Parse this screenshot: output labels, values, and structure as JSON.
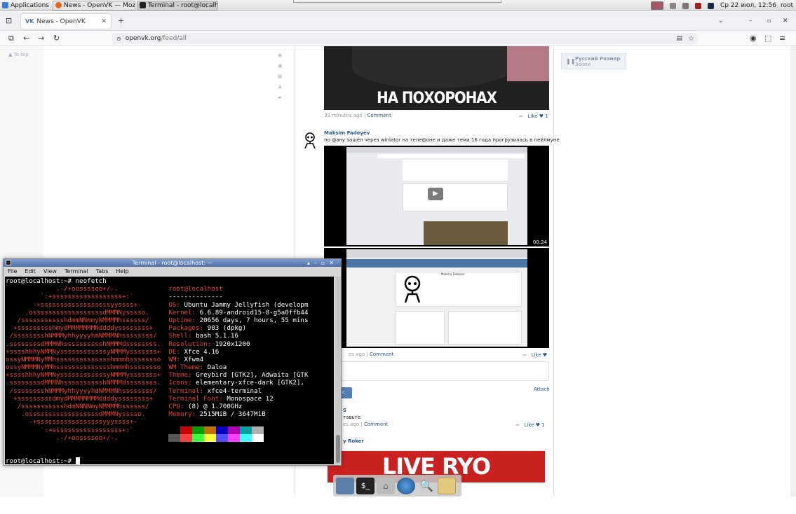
{
  "panel": {
    "apps_label": "Applications",
    "task1": "News - OpenVK — Mozil...",
    "task2": "Terminal - root@localho...",
    "clock": "Ср 22 июл, 12:56",
    "user": "root"
  },
  "browser": {
    "tab_title": "News - OpenVK",
    "url_host": "openvk.org",
    "url_path": "/feed/all"
  },
  "page": {
    "to_top": "To top",
    "right_box_line1": "Русский Размер",
    "right_box_line2": "Зоопи"
  },
  "posts": [
    {
      "image_caption": "НА ПОХОРОНАХ",
      "time": "33 minutes ago",
      "comment": "Comment",
      "like": "Like",
      "like_count": "1"
    },
    {
      "author": "Maksim Fadeyev",
      "text": "по фану зашёл через winlator на телефоне и даже тема 16 года прогрузилась в пейлмуне",
      "video_duration": "00:24",
      "time_partial": "es ago",
      "comment": "Comment",
      "like": "Like",
      "screenshot_name": "Maksim Fadeyev",
      "comment_attach": "Attach",
      "send_partial": "c"
    },
    {
      "author_partial": "S",
      "text_partial": "тавьте",
      "time_partial": "es ago",
      "comment": "Comment",
      "like": "Like",
      "like_count": "1"
    },
    {
      "author_partial": "y Roker",
      "banner": "LIVE RYO REACTION"
    }
  ],
  "terminal": {
    "title": "Terminal - root@localhost: ~",
    "menu": [
      "File",
      "Edit",
      "View",
      "Terminal",
      "Tabs",
      "Help"
    ],
    "prompt": "root@localhost:~# ",
    "command": "neofetch",
    "user_host": "root@localhost",
    "separator": "--------------",
    "info": [
      {
        "k": "OS",
        "v": "Ubuntu Jammy Jellyfish (developm"
      },
      {
        "k": "Kernel",
        "v": "6.6.89-android15-8-g5a0ffb44"
      },
      {
        "k": "Uptime",
        "v": "20656 days, 7 hours, 55 mins"
      },
      {
        "k": "Packages",
        "v": "903 (dpkg)"
      },
      {
        "k": "Shell",
        "v": "bash 5.1.16"
      },
      {
        "k": "Resolution",
        "v": "1920x1200"
      },
      {
        "k": "DE",
        "v": "Xfce 4.16"
      },
      {
        "k": "WM",
        "v": "Xfwm4"
      },
      {
        "k": "WM Theme",
        "v": "Daloa"
      },
      {
        "k": "Theme",
        "v": "Greybird [GTK2], Adwaita [GTK"
      },
      {
        "k": "Icons",
        "v": "elementary-xfce-dark [GTK2],"
      },
      {
        "k": "Terminal",
        "v": "xfce4-terminal"
      },
      {
        "k": "Terminal Font",
        "v": "Monospace 12"
      },
      {
        "k": "CPU",
        "v": "(8) @ 1.700GHz"
      },
      {
        "k": "Memory",
        "v": "2515MiB / 3647MiB"
      }
    ],
    "ascii": [
      "             .-/+oossssoo+/-.",
      "         `:+ssssssssssssssssss+:`",
      "       -+ssssssssssssssssssyyssss+-",
      "     .ossssssssssssssssssdMMMNysssso.",
      "   /ssssssssssshdmmNNmmyNMMMMhssssss/",
      "  +ssssssssshmydMMMMMMMNddddyssssssss+",
      " /sssssssshNMMMyhhyyyyhmNMMMNhssssssss/",
      ".ssssssssdMMMNhsssssssssshNMMMdssssssss.",
      "+sssshhhyNMMNyssssssssssssyNMMMysssssss+",
      "ossyNMMMNyMMhsssssssssssssshmmmhssssssso",
      "ossyNMMMNyMMhsssssssssssssshmmmhssssssso",
      "+sssshhhyNMMNyssssssssssssyNMMMysssssss+",
      ".ssssssssdMMMNhsssssssssshNMMMdssssssss.",
      " /sssssssshNMMMyhhyyyyhdNMMMNhssssssss/",
      "  +sssssssssdmydMMMMMMMMddddyssssssss+",
      "   /ssssssssssshdmNNNNmyNMMMMhssssss/",
      "    .ossssssssssssssssssdMMMNysssso.",
      "      -+sssssssssssssssssyyyssss+-",
      "         `:+ssssssssssssssssss+:`",
      "             .-/+oossssoo+/-."
    ],
    "colors_top": [
      "#000000",
      "#cc0000",
      "#00a000",
      "#c07000",
      "#0000c0",
      "#b000b0",
      "#00a0a0",
      "#b0b0b0"
    ],
    "colors_bottom": [
      "#555555",
      "#ff4040",
      "#40ff40",
      "#ffff40",
      "#5050ff",
      "#ff40ff",
      "#40ffff",
      "#ffffff"
    ],
    "final_prompt": "root@localhost:~# "
  }
}
